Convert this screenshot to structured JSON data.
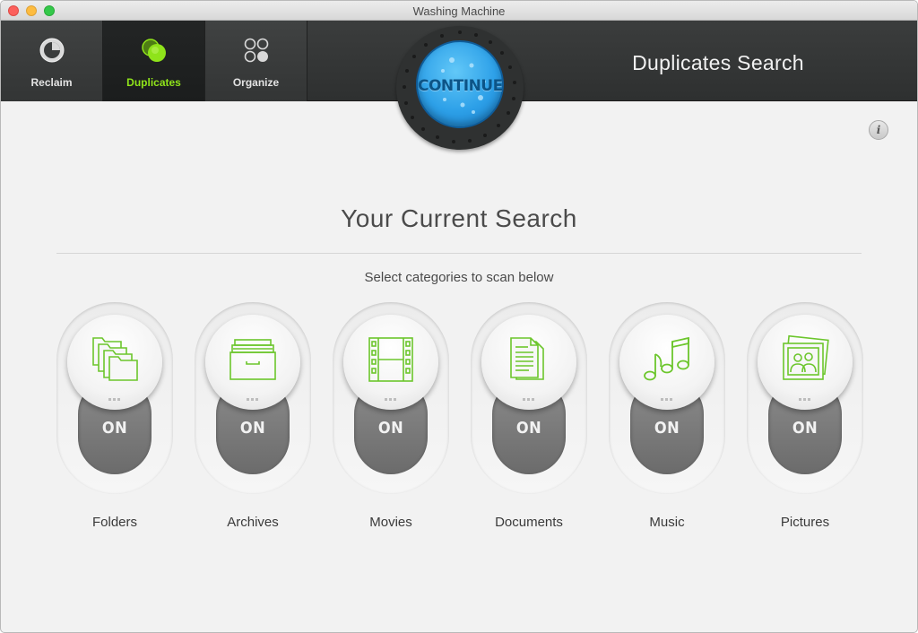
{
  "window": {
    "title": "Washing Machine"
  },
  "toolbar": {
    "tabs": [
      {
        "label": "Reclaim",
        "icon": "reclaim-icon",
        "active": false
      },
      {
        "label": "Duplicates",
        "icon": "duplicates-icon",
        "active": true
      },
      {
        "label": "Organize",
        "icon": "organize-icon",
        "active": false
      }
    ],
    "section_title": "Duplicates Search",
    "continue_label": "CONTINUE"
  },
  "main": {
    "title": "Your Current Search",
    "subtitle": "Select categories to scan below",
    "info_glyph": "i",
    "categories": [
      {
        "name": "Folders",
        "state": "ON",
        "icon": "folders-icon"
      },
      {
        "name": "Archives",
        "state": "ON",
        "icon": "archives-icon"
      },
      {
        "name": "Movies",
        "state": "ON",
        "icon": "movies-icon"
      },
      {
        "name": "Documents",
        "state": "ON",
        "icon": "documents-icon"
      },
      {
        "name": "Music",
        "state": "ON",
        "icon": "music-icon"
      },
      {
        "name": "Pictures",
        "state": "ON",
        "icon": "pictures-icon"
      }
    ]
  },
  "colors": {
    "accent_green": "#8fe31a",
    "icon_green": "#6cc62c",
    "continue_blue": "#2da0e8",
    "toolbar_dark": "#333535"
  }
}
